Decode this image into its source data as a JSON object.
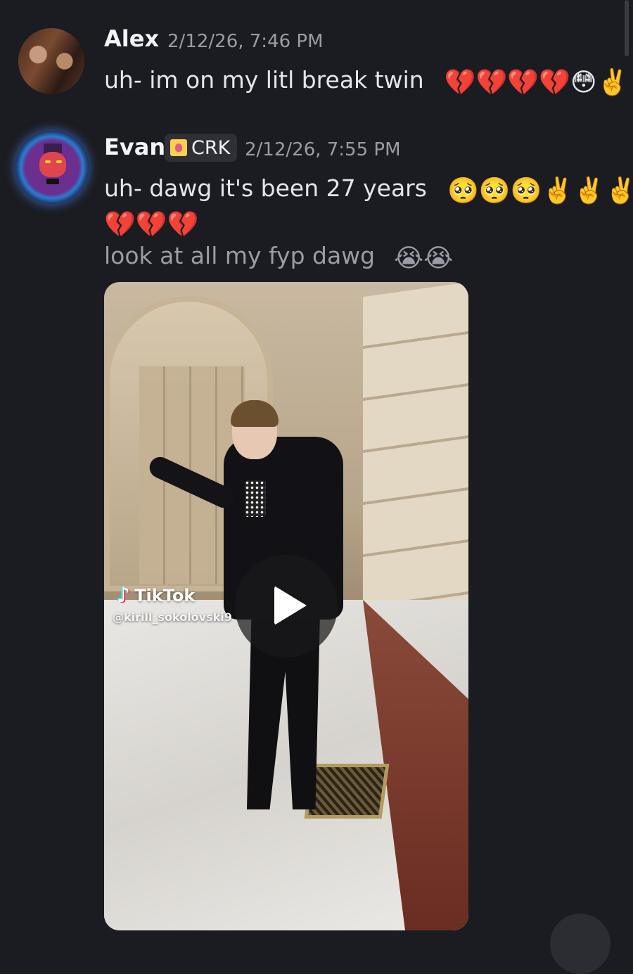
{
  "messages": [
    {
      "author": "Alex",
      "timestamp": "2/12/26, 7:46 PM",
      "lines": [
        {
          "text": "uh- im on my litl break twin",
          "emojis": [
            "💔",
            "💔",
            "💔",
            "💔",
            "😳",
            "✌️"
          ]
        }
      ]
    },
    {
      "author": "Evan",
      "tag": {
        "icon": "crk-badge-icon",
        "label": "CRK"
      },
      "timestamp": "2/12/26, 7:55 PM",
      "lines": [
        {
          "text": "uh- dawg it's been 27 years",
          "emojis": [
            "🥺",
            "🥺",
            "🥺",
            "✌️",
            "✌️",
            "✌️"
          ]
        },
        {
          "text": "",
          "emojis": [
            "💔",
            "💔",
            "💔"
          ]
        },
        {
          "text": "look at all my fyp dawg",
          "emojis": [
            "😭",
            "😭"
          ]
        }
      ],
      "embed": {
        "platform": "TikTok",
        "handle": "@kirill_sokolovski9",
        "icon": "play-icon"
      }
    }
  ]
}
